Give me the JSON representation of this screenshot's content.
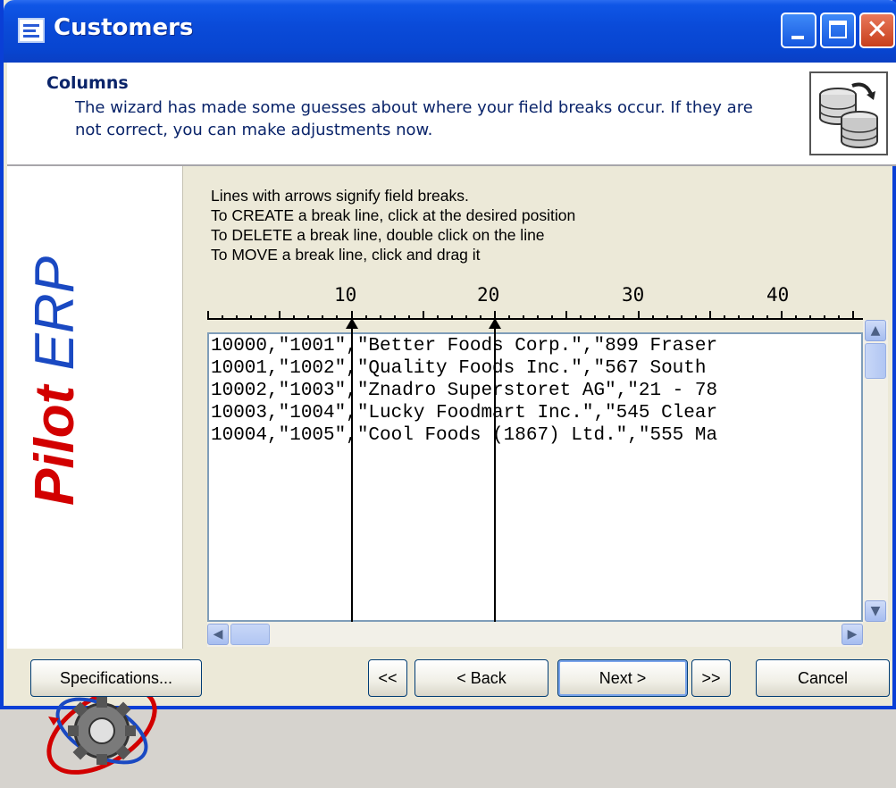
{
  "window": {
    "title": "Customers"
  },
  "header": {
    "title": "Columns",
    "description": "The wizard has made some guesses about where your field breaks occur. If they are not correct, you can make adjustments now."
  },
  "logo": {
    "word1": "Pilot",
    "word2": "ERP"
  },
  "instructions": [
    "Lines with arrows signify field breaks.",
    "To CREATE a break line, click at the desired position",
    "To DELETE a break line, double click on the line",
    "To MOVE a break line, click and drag it"
  ],
  "ruler": {
    "labels": [
      "10",
      "20",
      "30",
      "40"
    ]
  },
  "preview_lines": [
    "10000,\"1001\",\"Better Foods Corp.\",\"899 Fraser",
    "10001,\"1002\",\"Quality Foods Inc.\",\"567 South",
    "10002,\"1003\",\"Znadro Superstoret AG\",\"21 - 78",
    "10003,\"1004\",\"Lucky Foodmart Inc.\",\"545 Clear",
    "10004,\"1005\",\"Cool Foods (1867) Ltd.\",\"555 Ma"
  ],
  "break_positions": [
    10,
    20
  ],
  "buttons": {
    "specifications": "Specifications...",
    "first": "<<",
    "back": "< Back",
    "next": "Next >",
    "last": ">>",
    "cancel": "Cancel"
  },
  "colors": {
    "titlebar": "#0a4bd9",
    "header_text": "#0a246a",
    "logo_red": "#d20000",
    "logo_blue": "#1a49c2"
  }
}
